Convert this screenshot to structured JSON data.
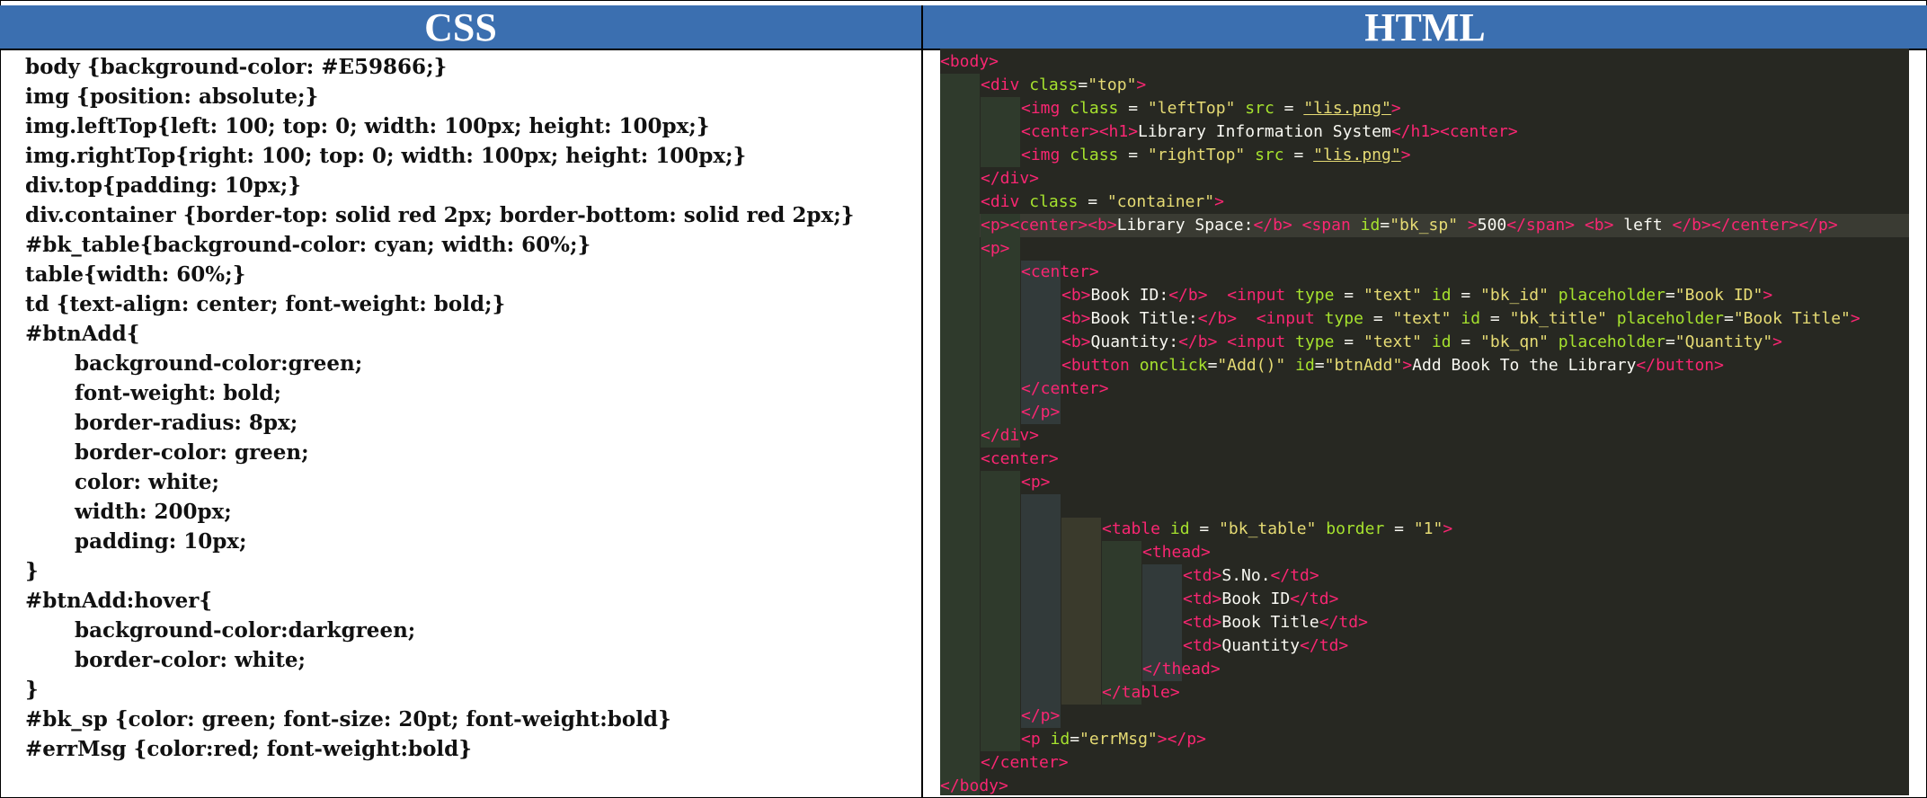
{
  "headers": {
    "css": "CSS",
    "html": "HTML"
  },
  "css_lines": [
    {
      "text": "body {background-color: #E59866;}",
      "indent": false
    },
    {
      "text": "img {position: absolute;}",
      "indent": false
    },
    {
      "text": "img.leftTop{left: 100; top: 0; width: 100px; height: 100px;}",
      "indent": false
    },
    {
      "text": "img.rightTop{right: 100; top: 0; width: 100px; height: 100px;}",
      "indent": false
    },
    {
      "text": "div.top{padding: 10px;}",
      "indent": false
    },
    {
      "text": "div.container {border-top: solid red 2px; border-bottom: solid red 2px;}",
      "indent": false
    },
    {
      "text": "#bk_table{background-color: cyan; width: 60%;}",
      "indent": false
    },
    {
      "text": "table{width: 60%;}",
      "indent": false
    },
    {
      "text": "td {text-align: center; font-weight: bold;}",
      "indent": false
    },
    {
      "text": "#btnAdd{",
      "indent": false
    },
    {
      "text": "background-color:green;",
      "indent": true
    },
    {
      "text": "font-weight: bold;",
      "indent": true
    },
    {
      "text": "border-radius: 8px;",
      "indent": true
    },
    {
      "text": "border-color: green;",
      "indent": true
    },
    {
      "text": "color: white;",
      "indent": true
    },
    {
      "text": "width: 200px;",
      "indent": true
    },
    {
      "text": "padding: 10px;",
      "indent": true
    },
    {
      "text": "}",
      "indent": false
    },
    {
      "text": "#btnAdd:hover{",
      "indent": false
    },
    {
      "text": "background-color:darkgreen;",
      "indent": true
    },
    {
      "text": "border-color: white;",
      "indent": true
    },
    {
      "text": "}",
      "indent": false
    },
    {
      "text": "#bk_sp {color: green; font-size: 20pt; font-weight:bold}",
      "indent": false
    },
    {
      "text": "#errMsg {color:red; font-weight:bold}",
      "indent": false
    }
  ],
  "html_lines": [
    {
      "indent": 0,
      "tokens": [
        [
          "tag",
          "<body>"
        ]
      ]
    },
    {
      "indent": 1,
      "tokens": [
        [
          "tag",
          "<div "
        ],
        [
          "attr",
          "class"
        ],
        [
          "pun",
          "="
        ],
        [
          "str",
          "\"top\""
        ],
        [
          "tag",
          ">"
        ]
      ]
    },
    {
      "indent": 2,
      "tokens": [
        [
          "tag",
          "<img "
        ],
        [
          "attr",
          "class"
        ],
        [
          "pun",
          " = "
        ],
        [
          "str",
          "\"leftTop\""
        ],
        [
          "attr",
          " src"
        ],
        [
          "pun",
          " = "
        ],
        [
          "str",
          "\"lis.png\""
        ],
        [
          "tag",
          ">"
        ]
      ]
    },
    {
      "indent": 2,
      "tokens": [
        [
          "tag",
          "<center><h1>"
        ],
        [
          "pun",
          "Library Information System"
        ],
        [
          "tag",
          "</h1><center>"
        ]
      ]
    },
    {
      "indent": 2,
      "tokens": [
        [
          "tag",
          "<img "
        ],
        [
          "attr",
          "class"
        ],
        [
          "pun",
          " = "
        ],
        [
          "str",
          "\"rightTop\""
        ],
        [
          "attr",
          " src"
        ],
        [
          "pun",
          " = "
        ],
        [
          "str",
          "\"lis.png\""
        ],
        [
          "tag",
          ">"
        ]
      ]
    },
    {
      "indent": 1,
      "tokens": [
        [
          "tag",
          "</div>"
        ]
      ]
    },
    {
      "indent": 1,
      "tokens": [
        [
          "tag",
          "<div "
        ],
        [
          "attr",
          "class"
        ],
        [
          "pun",
          " = "
        ],
        [
          "str",
          "\"container\""
        ],
        [
          "tag",
          ">"
        ]
      ]
    },
    {
      "indent": 1,
      "tokens": [
        [
          "tag",
          "<p><center><b>"
        ],
        [
          "pun",
          "Library Space:"
        ],
        [
          "tag",
          "</b> <span "
        ],
        [
          "attr",
          "id"
        ],
        [
          "pun",
          "="
        ],
        [
          "str",
          "\"bk_sp\""
        ],
        [
          "tag",
          " >"
        ],
        [
          "pun",
          "500"
        ],
        [
          "tag",
          "</span> <b>"
        ],
        [
          "pun",
          " left "
        ],
        [
          "tag",
          "</b></center></p>"
        ]
      ]
    },
    {
      "indent": 1,
      "tokens": [
        [
          "tag",
          "<p>"
        ]
      ]
    },
    {
      "indent": 2,
      "tokens": [
        [
          "tag",
          "<center>"
        ]
      ]
    },
    {
      "indent": 3,
      "tokens": [
        [
          "tag",
          "<b>"
        ],
        [
          "pun",
          "Book ID:"
        ],
        [
          "tag",
          "</b>  <input "
        ],
        [
          "attr",
          "type"
        ],
        [
          "pun",
          " = "
        ],
        [
          "str",
          "\"text\""
        ],
        [
          "attr",
          " id"
        ],
        [
          "pun",
          " = "
        ],
        [
          "str",
          "\"bk_id\""
        ],
        [
          "attr",
          " placeholder"
        ],
        [
          "pun",
          "="
        ],
        [
          "str",
          "\"Book ID\""
        ],
        [
          "tag",
          ">"
        ]
      ]
    },
    {
      "indent": 3,
      "tokens": [
        [
          "tag",
          "<b>"
        ],
        [
          "pun",
          "Book Title:"
        ],
        [
          "tag",
          "</b>  <input "
        ],
        [
          "attr",
          "type"
        ],
        [
          "pun",
          " = "
        ],
        [
          "str",
          "\"text\""
        ],
        [
          "attr",
          " id"
        ],
        [
          "pun",
          " = "
        ],
        [
          "str",
          "\"bk_title\""
        ],
        [
          "attr",
          " placeholder"
        ],
        [
          "pun",
          "="
        ],
        [
          "str",
          "\"Book Title\""
        ],
        [
          "tag",
          ">"
        ]
      ]
    },
    {
      "indent": 3,
      "tokens": [
        [
          "tag",
          "<b>"
        ],
        [
          "pun",
          "Quantity:"
        ],
        [
          "tag",
          "</b> <input "
        ],
        [
          "attr",
          "type"
        ],
        [
          "pun",
          " = "
        ],
        [
          "str",
          "\"text\""
        ],
        [
          "attr",
          " id"
        ],
        [
          "pun",
          " = "
        ],
        [
          "str",
          "\"bk_qn\""
        ],
        [
          "attr",
          " placeholder"
        ],
        [
          "pun",
          "="
        ],
        [
          "str",
          "\"Quantity\""
        ],
        [
          "tag",
          ">"
        ]
      ]
    },
    {
      "indent": 3,
      "tokens": [
        [
          "tag",
          "<button "
        ],
        [
          "attr",
          "onclick"
        ],
        [
          "pun",
          "="
        ],
        [
          "str",
          "\"Add()\""
        ],
        [
          "attr",
          " id"
        ],
        [
          "pun",
          "="
        ],
        [
          "str",
          "\"btnAdd\""
        ],
        [
          "tag",
          ">"
        ],
        [
          "pun",
          "Add Book To the Library"
        ],
        [
          "tag",
          "</button>"
        ]
      ]
    },
    {
      "indent": 2,
      "tokens": [
        [
          "tag",
          "</center>"
        ]
      ]
    },
    {
      "indent": 2,
      "tokens": [
        [
          "tag",
          "</p>"
        ]
      ]
    },
    {
      "indent": 1,
      "tokens": [
        [
          "tag",
          "</div>"
        ]
      ]
    },
    {
      "indent": 1,
      "tokens": [
        [
          "tag",
          "<center>"
        ]
      ]
    },
    {
      "indent": 2,
      "tokens": [
        [
          "tag",
          "<p>"
        ]
      ]
    },
    {
      "indent": 0,
      "tokens": []
    },
    {
      "indent": 4,
      "tokens": [
        [
          "tag",
          "<table "
        ],
        [
          "attr",
          "id"
        ],
        [
          "pun",
          " = "
        ],
        [
          "str",
          "\"bk_table\""
        ],
        [
          "attr",
          " border"
        ],
        [
          "pun",
          " = "
        ],
        [
          "str",
          "\"1\""
        ],
        [
          "tag",
          ">"
        ]
      ]
    },
    {
      "indent": 5,
      "tokens": [
        [
          "tag",
          "<thead>"
        ]
      ]
    },
    {
      "indent": 6,
      "tokens": [
        [
          "tag",
          "<td>"
        ],
        [
          "pun",
          "S.No."
        ],
        [
          "tag",
          "</td>"
        ]
      ]
    },
    {
      "indent": 6,
      "tokens": [
        [
          "tag",
          "<td>"
        ],
        [
          "pun",
          "Book ID"
        ],
        [
          "tag",
          "</td>"
        ]
      ]
    },
    {
      "indent": 6,
      "tokens": [
        [
          "tag",
          "<td>"
        ],
        [
          "pun",
          "Book Title"
        ],
        [
          "tag",
          "</td>"
        ]
      ]
    },
    {
      "indent": 6,
      "tokens": [
        [
          "tag",
          "<td>"
        ],
        [
          "pun",
          "Quantity"
        ],
        [
          "tag",
          "</td>"
        ]
      ]
    },
    {
      "indent": 5,
      "tokens": [
        [
          "tag",
          "</thead>"
        ]
      ]
    },
    {
      "indent": 4,
      "tokens": [
        [
          "tag",
          "</table>"
        ]
      ]
    },
    {
      "indent": 2,
      "tokens": [
        [
          "tag",
          "</p>"
        ]
      ]
    },
    {
      "indent": 2,
      "tokens": [
        [
          "tag",
          "<p "
        ],
        [
          "attr",
          "id"
        ],
        [
          "pun",
          "="
        ],
        [
          "str",
          "\"errMsg\""
        ],
        [
          "tag",
          "></p>"
        ]
      ]
    },
    {
      "indent": 1,
      "tokens": [
        [
          "tag",
          "</center>"
        ]
      ]
    },
    {
      "indent": 0,
      "tokens": [
        [
          "tag",
          "</body>"
        ]
      ]
    }
  ]
}
